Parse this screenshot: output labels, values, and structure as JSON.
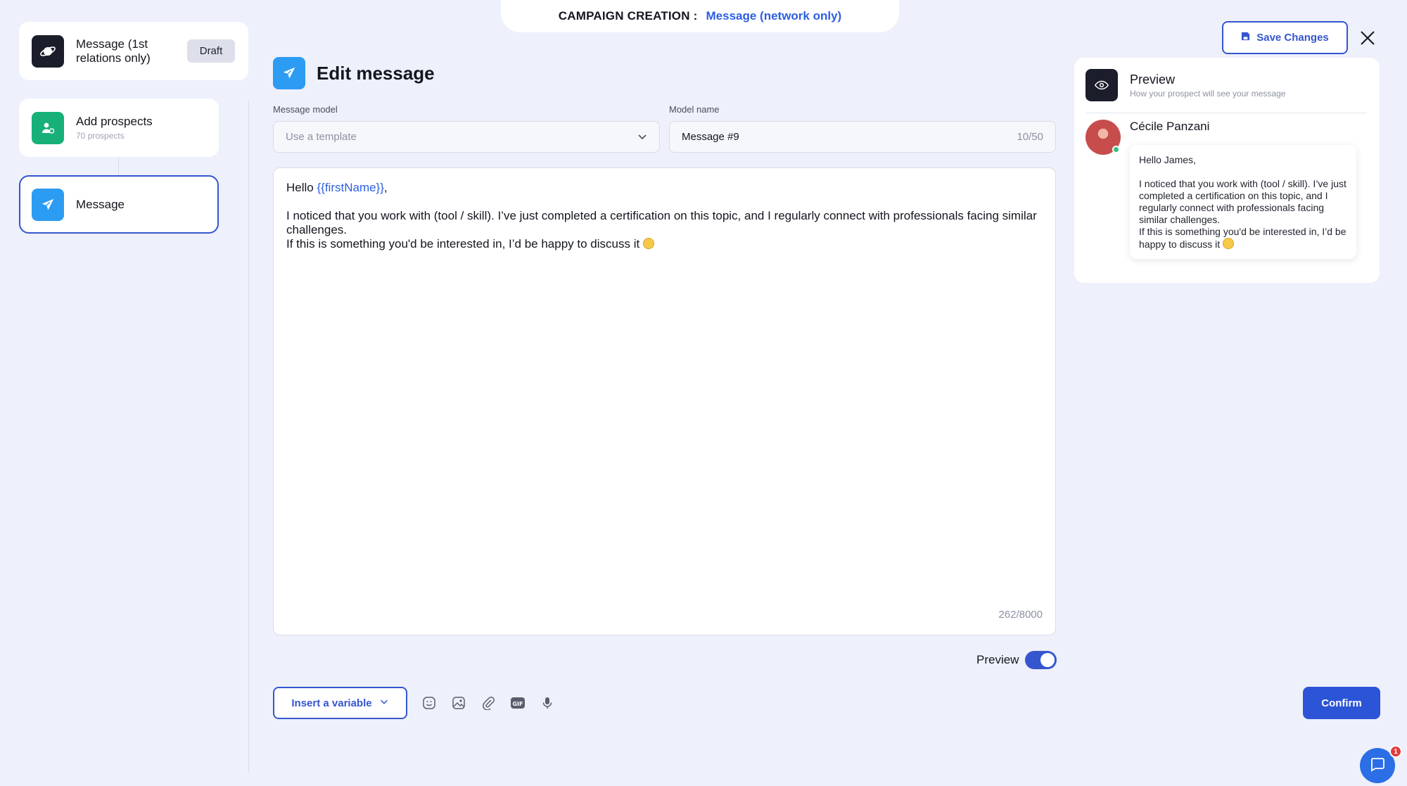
{
  "header": {
    "label": "CAMPAIGN CREATION :",
    "value": "Message (network only)"
  },
  "steps": [
    {
      "title": "Message (1st relations only)",
      "badge": "Draft",
      "icon": "planet-icon",
      "color": "#1b1d2b"
    },
    {
      "title": "Add prospects",
      "subtitle": "70 prospects",
      "icon": "user-add-icon",
      "color": "#17b079"
    },
    {
      "title": "Message",
      "icon": "send-icon",
      "color": "#2c9cf2"
    }
  ],
  "edit": {
    "title": "Edit message",
    "model_label": "Message model",
    "model_placeholder": "Use a template",
    "name_label": "Model name",
    "name_value": "Message #9",
    "name_count": "10/50"
  },
  "message": {
    "greeting": "Hello ",
    "variable": "{{firstName}}",
    "greeting_end": ",",
    "line1": "I noticed that you work with (tool / skill). I’ve just completed a certification on this topic, and I regularly connect with professionals facing similar challenges.",
    "line2": "If this is something you'd be interested in, I’d be happy to discuss it ",
    "counter": "262/8000"
  },
  "toolbar": {
    "preview_label": "Preview",
    "preview_on": true,
    "insert_variable": "Insert a variable",
    "icons": [
      "emoji-icon",
      "image-icon",
      "attachment-icon",
      "gif-icon",
      "microphone-icon"
    ]
  },
  "actions": {
    "save": "Save Changes",
    "confirm": "Confirm"
  },
  "preview": {
    "title": "Preview",
    "subtitle": "How your prospect will see your message",
    "sender": "Cécile Panzani",
    "greeting": "Hello James,",
    "body1": "I noticed that you work with (tool / skill). I’ve just completed a certification on this topic, and I regularly connect with professionals facing similar challenges.",
    "body2": "If this is something you'd be interested in, I’d be happy to discuss it "
  },
  "chat": {
    "badge": "1"
  },
  "colors": {
    "accent": "#3556cf",
    "link": "#2c5fe0",
    "background": "#eef0fb"
  }
}
